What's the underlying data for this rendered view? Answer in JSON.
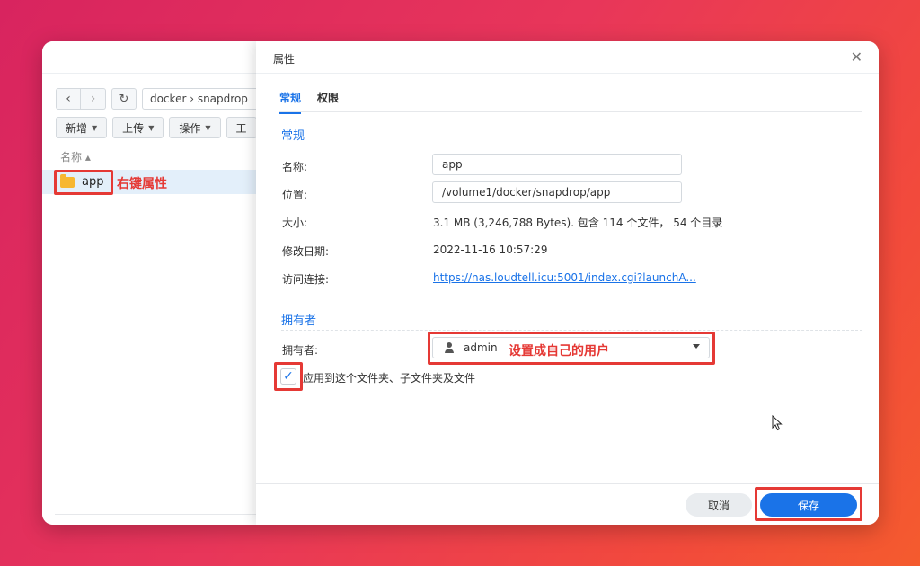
{
  "file_station": {
    "path": "docker › snapdrop",
    "toolbar": [
      {
        "label": "新增"
      },
      {
        "label": "上传"
      },
      {
        "label": "操作"
      },
      {
        "label": "工"
      }
    ],
    "column_header": "名称 ▴",
    "files": [
      {
        "name": "app",
        "selected": true
      }
    ],
    "annotation": "右键属性"
  },
  "dialog": {
    "title": "属性",
    "tabs": [
      {
        "label": "常规",
        "active": true
      },
      {
        "label": "权限",
        "active": false
      }
    ],
    "general": {
      "section_title": "常规",
      "name_label": "名称:",
      "name_value": "app",
      "location_label": "位置:",
      "location_value": "/volume1/docker/snapdrop/app",
      "size_label": "大小:",
      "size_value": "3.1 MB (3,246,788 Bytes). 包含 114 个文件， 54 个目录",
      "modified_label": "修改日期:",
      "modified_value": "2022-11-16 10:57:29",
      "link_label": "访问连接:",
      "link_value": "https://nas.loudtell.icu:5001/index.cgi?launchA..."
    },
    "owner": {
      "section_title": "拥有者",
      "owner_label": "拥有者:",
      "owner_value": "admin",
      "owner_annotation": "设置成自己的用户",
      "apply_label": "应用到这个文件夹、子文件夹及文件",
      "apply_checked": true
    },
    "buttons": {
      "cancel": "取消",
      "save": "保存"
    }
  },
  "colors": {
    "accent": "#1a73e8",
    "annotation_red": "#e53935",
    "folder": "#f7b731"
  }
}
